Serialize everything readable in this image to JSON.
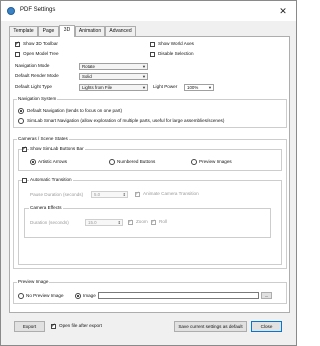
{
  "window": {
    "title": "PDF Settings"
  },
  "tabs": [
    {
      "label": "Template"
    },
    {
      "label": "Page"
    },
    {
      "label": "3D"
    },
    {
      "label": "Animation"
    },
    {
      "label": "Advanced"
    }
  ],
  "options": {
    "show_3d_toolbar": "Show 3D Toolbar",
    "open_model_tree": "Open Model Tree",
    "show_world_axes": "Show World Axes",
    "disable_selection": "Disable Selection"
  },
  "fields": {
    "navigation_mode": {
      "label": "Navigation Mode",
      "value": "Rotate"
    },
    "render_mode": {
      "label": "Default Render Mode",
      "value": "Solid"
    },
    "light_type": {
      "label": "Default Light Type",
      "value": "Lights from File"
    },
    "light_power": {
      "label": "Light Power",
      "value": "100%"
    }
  },
  "navigation_system": {
    "title": "Navigation System",
    "default": "Default Navigation (tends to focus on one part)",
    "smart": "SimLab Smart Navigation (allow exploration of multiple parts, useful for large assemblies/scenes)"
  },
  "cameras": {
    "title": "Cameras / Scene States",
    "show_buttons_bar": "Show SimLab Buttons Bar",
    "artistic_arrows": "Artistic Arrows",
    "numbered_buttons": "Numbered Buttons",
    "preview_images": "Preview Images",
    "automatic_transition": "Automatic Transition",
    "pause_duration_label": "Pause Duration (seconds)",
    "pause_duration_value": "5.0",
    "animate_transition": "Animate Camera Transition",
    "camera_effects_title": "Camera Effects",
    "duration_label": "Duration (seconds)",
    "duration_value": "15.0",
    "zoom": "Zoom",
    "roll": "Roll"
  },
  "preview_image": {
    "title": "Preview Image",
    "no_preview": "No Preview Image",
    "image": "Image",
    "browse": "..."
  },
  "footer": {
    "export": "Export",
    "open_file_after_export": "Open file after export",
    "save_default": "Save current settings as default",
    "close": "Close"
  }
}
